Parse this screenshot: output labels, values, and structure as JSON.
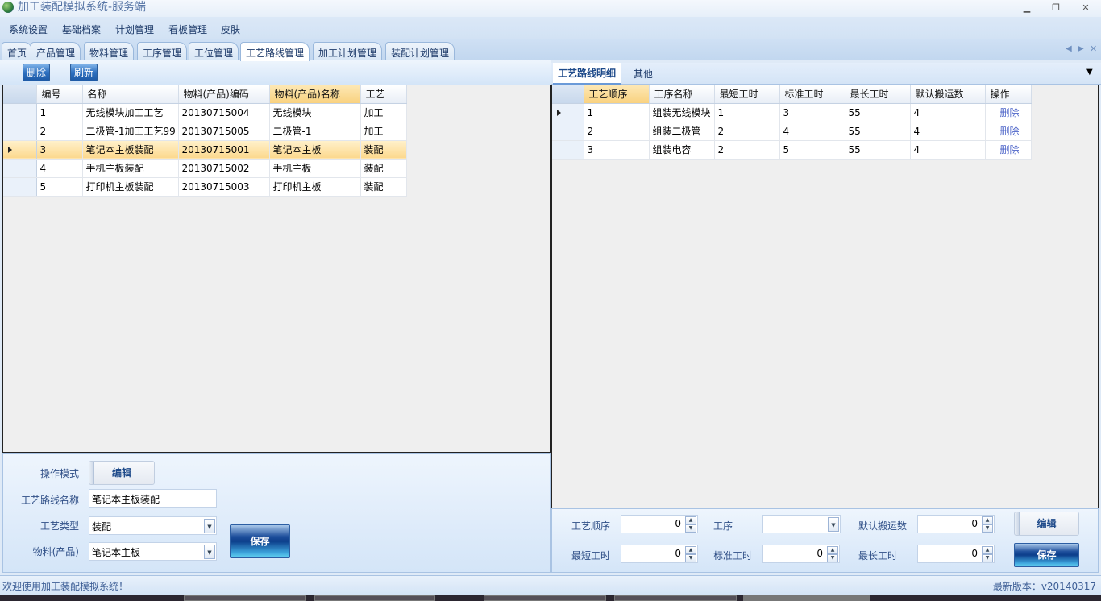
{
  "window": {
    "title": "加工装配模拟系统-服务端",
    "minimize": "▁",
    "restore": "❐",
    "close": "✕"
  },
  "menu": [
    "系统设置",
    "基础档案",
    "计划管理",
    "看板管理",
    "皮肤"
  ],
  "tabs": [
    "首页",
    "产品管理",
    "物料管理",
    "工序管理",
    "工位管理",
    "工艺路线管理",
    "加工计划管理",
    "装配计划管理"
  ],
  "active_tab": 5,
  "left": {
    "toolbar": {
      "delete": "删除",
      "refresh": "刷新"
    },
    "columns": [
      "编号",
      "名称",
      "物料(产品)编码",
      "物料(产品)名称",
      "工艺"
    ],
    "rows": [
      [
        "1",
        "无线模块加工工艺",
        "20130715004",
        "无线模块",
        "加工"
      ],
      [
        "2",
        "二极管-1加工工艺99",
        "20130715005",
        "二极管-1",
        "加工"
      ],
      [
        "3",
        "笔记本主板装配",
        "20130715001",
        "笔记本主板",
        "装配"
      ],
      [
        "4",
        "手机主板装配",
        "20130715002",
        "手机主板",
        "装配"
      ],
      [
        "5",
        "打印机主板装配",
        "20130715003",
        "打印机主板",
        "装配"
      ]
    ],
    "selected_row": 2,
    "form": {
      "mode_label": "操作模式",
      "mode_value": "编辑",
      "name_label": "工艺路线名称",
      "name_value": "笔记本主板装配",
      "type_label": "工艺类型",
      "type_value": "装配",
      "material_label": "物料(产品)",
      "material_value": "笔记本主板",
      "save": "保存"
    }
  },
  "right": {
    "tabs": [
      "工艺路线明细",
      "其他"
    ],
    "columns": [
      "工艺顺序",
      "工序名称",
      "最短工时",
      "标准工时",
      "最长工时",
      "默认搬运数",
      "操作"
    ],
    "rows": [
      [
        "1",
        "组装无线模块",
        "1",
        "3",
        "55",
        "4",
        "删除"
      ],
      [
        "2",
        "组装二极管",
        "2",
        "4",
        "55",
        "4",
        "删除"
      ],
      [
        "3",
        "组装电容",
        "2",
        "5",
        "55",
        "4",
        "删除"
      ]
    ],
    "form": {
      "seq_label": "工艺顺序",
      "seq_value": "0",
      "proc_label": "工序",
      "proc_value": "",
      "carry_label": "默认搬运数",
      "carry_value": "0",
      "min_label": "最短工时",
      "min_value": "0",
      "std_label": "标准工时",
      "std_value": "0",
      "max_label": "最长工时",
      "max_value": "0",
      "edit": "编辑",
      "save": "保存"
    }
  },
  "status": {
    "left": "欢迎使用加工装配模拟系统！",
    "right": "最新版本：v20140317"
  }
}
